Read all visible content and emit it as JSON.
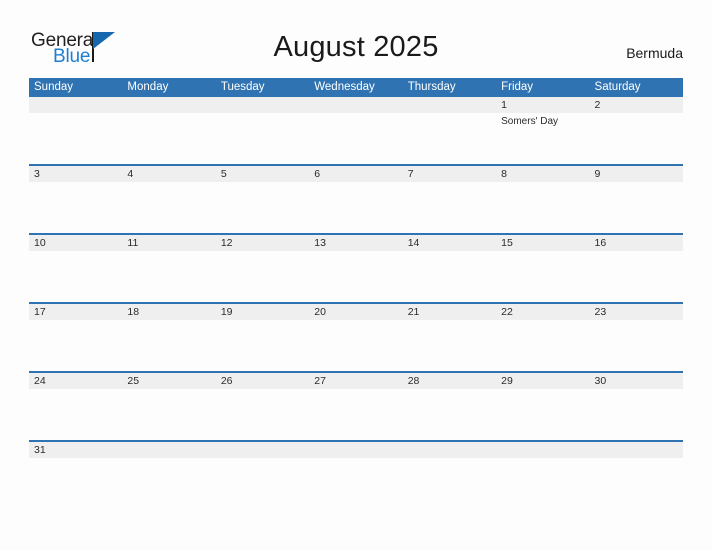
{
  "logo": {
    "text_primary": "General",
    "text_secondary": "Blue",
    "flag_icon": "blue-triangle-flag-icon",
    "primary_color": "#231f20",
    "secondary_color": "#1d7fd0",
    "flag_color": "#1667ad"
  },
  "header": {
    "title": "August 2025",
    "region": "Bermuda"
  },
  "theme": {
    "header_bar_color": "#2f73b3",
    "divider_color": "#2f73b3",
    "date_strip_color": "#efefef",
    "page_background": "#fdfdfd",
    "text_color": "#2b2b2b"
  },
  "calendar": {
    "month": "August",
    "year": "2025",
    "weekday_headers": [
      "Sunday",
      "Monday",
      "Tuesday",
      "Wednesday",
      "Thursday",
      "Friday",
      "Saturday"
    ],
    "weeks": [
      {
        "days": [
          {
            "date": "",
            "events": []
          },
          {
            "date": "",
            "events": []
          },
          {
            "date": "",
            "events": []
          },
          {
            "date": "",
            "events": []
          },
          {
            "date": "",
            "events": []
          },
          {
            "date": "1",
            "events": [
              "Somers' Day"
            ]
          },
          {
            "date": "2",
            "events": []
          }
        ]
      },
      {
        "days": [
          {
            "date": "3",
            "events": []
          },
          {
            "date": "4",
            "events": []
          },
          {
            "date": "5",
            "events": []
          },
          {
            "date": "6",
            "events": []
          },
          {
            "date": "7",
            "events": []
          },
          {
            "date": "8",
            "events": []
          },
          {
            "date": "9",
            "events": []
          }
        ]
      },
      {
        "days": [
          {
            "date": "10",
            "events": []
          },
          {
            "date": "11",
            "events": []
          },
          {
            "date": "12",
            "events": []
          },
          {
            "date": "13",
            "events": []
          },
          {
            "date": "14",
            "events": []
          },
          {
            "date": "15",
            "events": []
          },
          {
            "date": "16",
            "events": []
          }
        ]
      },
      {
        "days": [
          {
            "date": "17",
            "events": []
          },
          {
            "date": "18",
            "events": []
          },
          {
            "date": "19",
            "events": []
          },
          {
            "date": "20",
            "events": []
          },
          {
            "date": "21",
            "events": []
          },
          {
            "date": "22",
            "events": []
          },
          {
            "date": "23",
            "events": []
          }
        ]
      },
      {
        "days": [
          {
            "date": "24",
            "events": []
          },
          {
            "date": "25",
            "events": []
          },
          {
            "date": "26",
            "events": []
          },
          {
            "date": "27",
            "events": []
          },
          {
            "date": "28",
            "events": []
          },
          {
            "date": "29",
            "events": []
          },
          {
            "date": "30",
            "events": []
          }
        ]
      },
      {
        "days": [
          {
            "date": "31",
            "events": []
          },
          {
            "date": "",
            "events": []
          },
          {
            "date": "",
            "events": []
          },
          {
            "date": "",
            "events": []
          },
          {
            "date": "",
            "events": []
          },
          {
            "date": "",
            "events": []
          },
          {
            "date": "",
            "events": []
          }
        ]
      }
    ]
  }
}
